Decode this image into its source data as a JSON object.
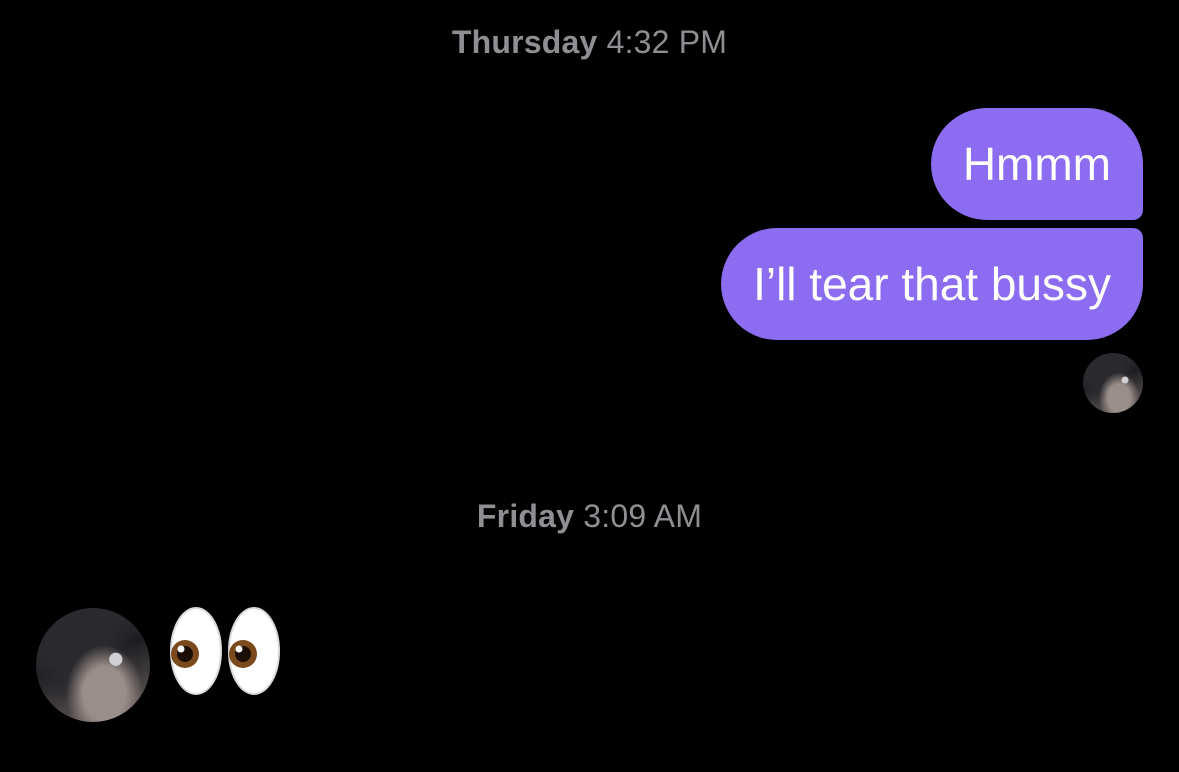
{
  "thread": {
    "timestamps": [
      {
        "day": "Thursday",
        "time": "4:32 PM"
      },
      {
        "day": "Friday",
        "time": "3:09 AM"
      }
    ],
    "outgoing_messages": [
      {
        "text": "Hmmm"
      },
      {
        "text": "I’ll tear that bussy"
      }
    ],
    "incoming_messages": [
      {
        "text": "👀",
        "icon": "eyes-emoji"
      }
    ]
  },
  "colors": {
    "background": "#000000",
    "outgoing_bubble": "#8c6cf0",
    "timestamp_text": "#8e8e93"
  }
}
